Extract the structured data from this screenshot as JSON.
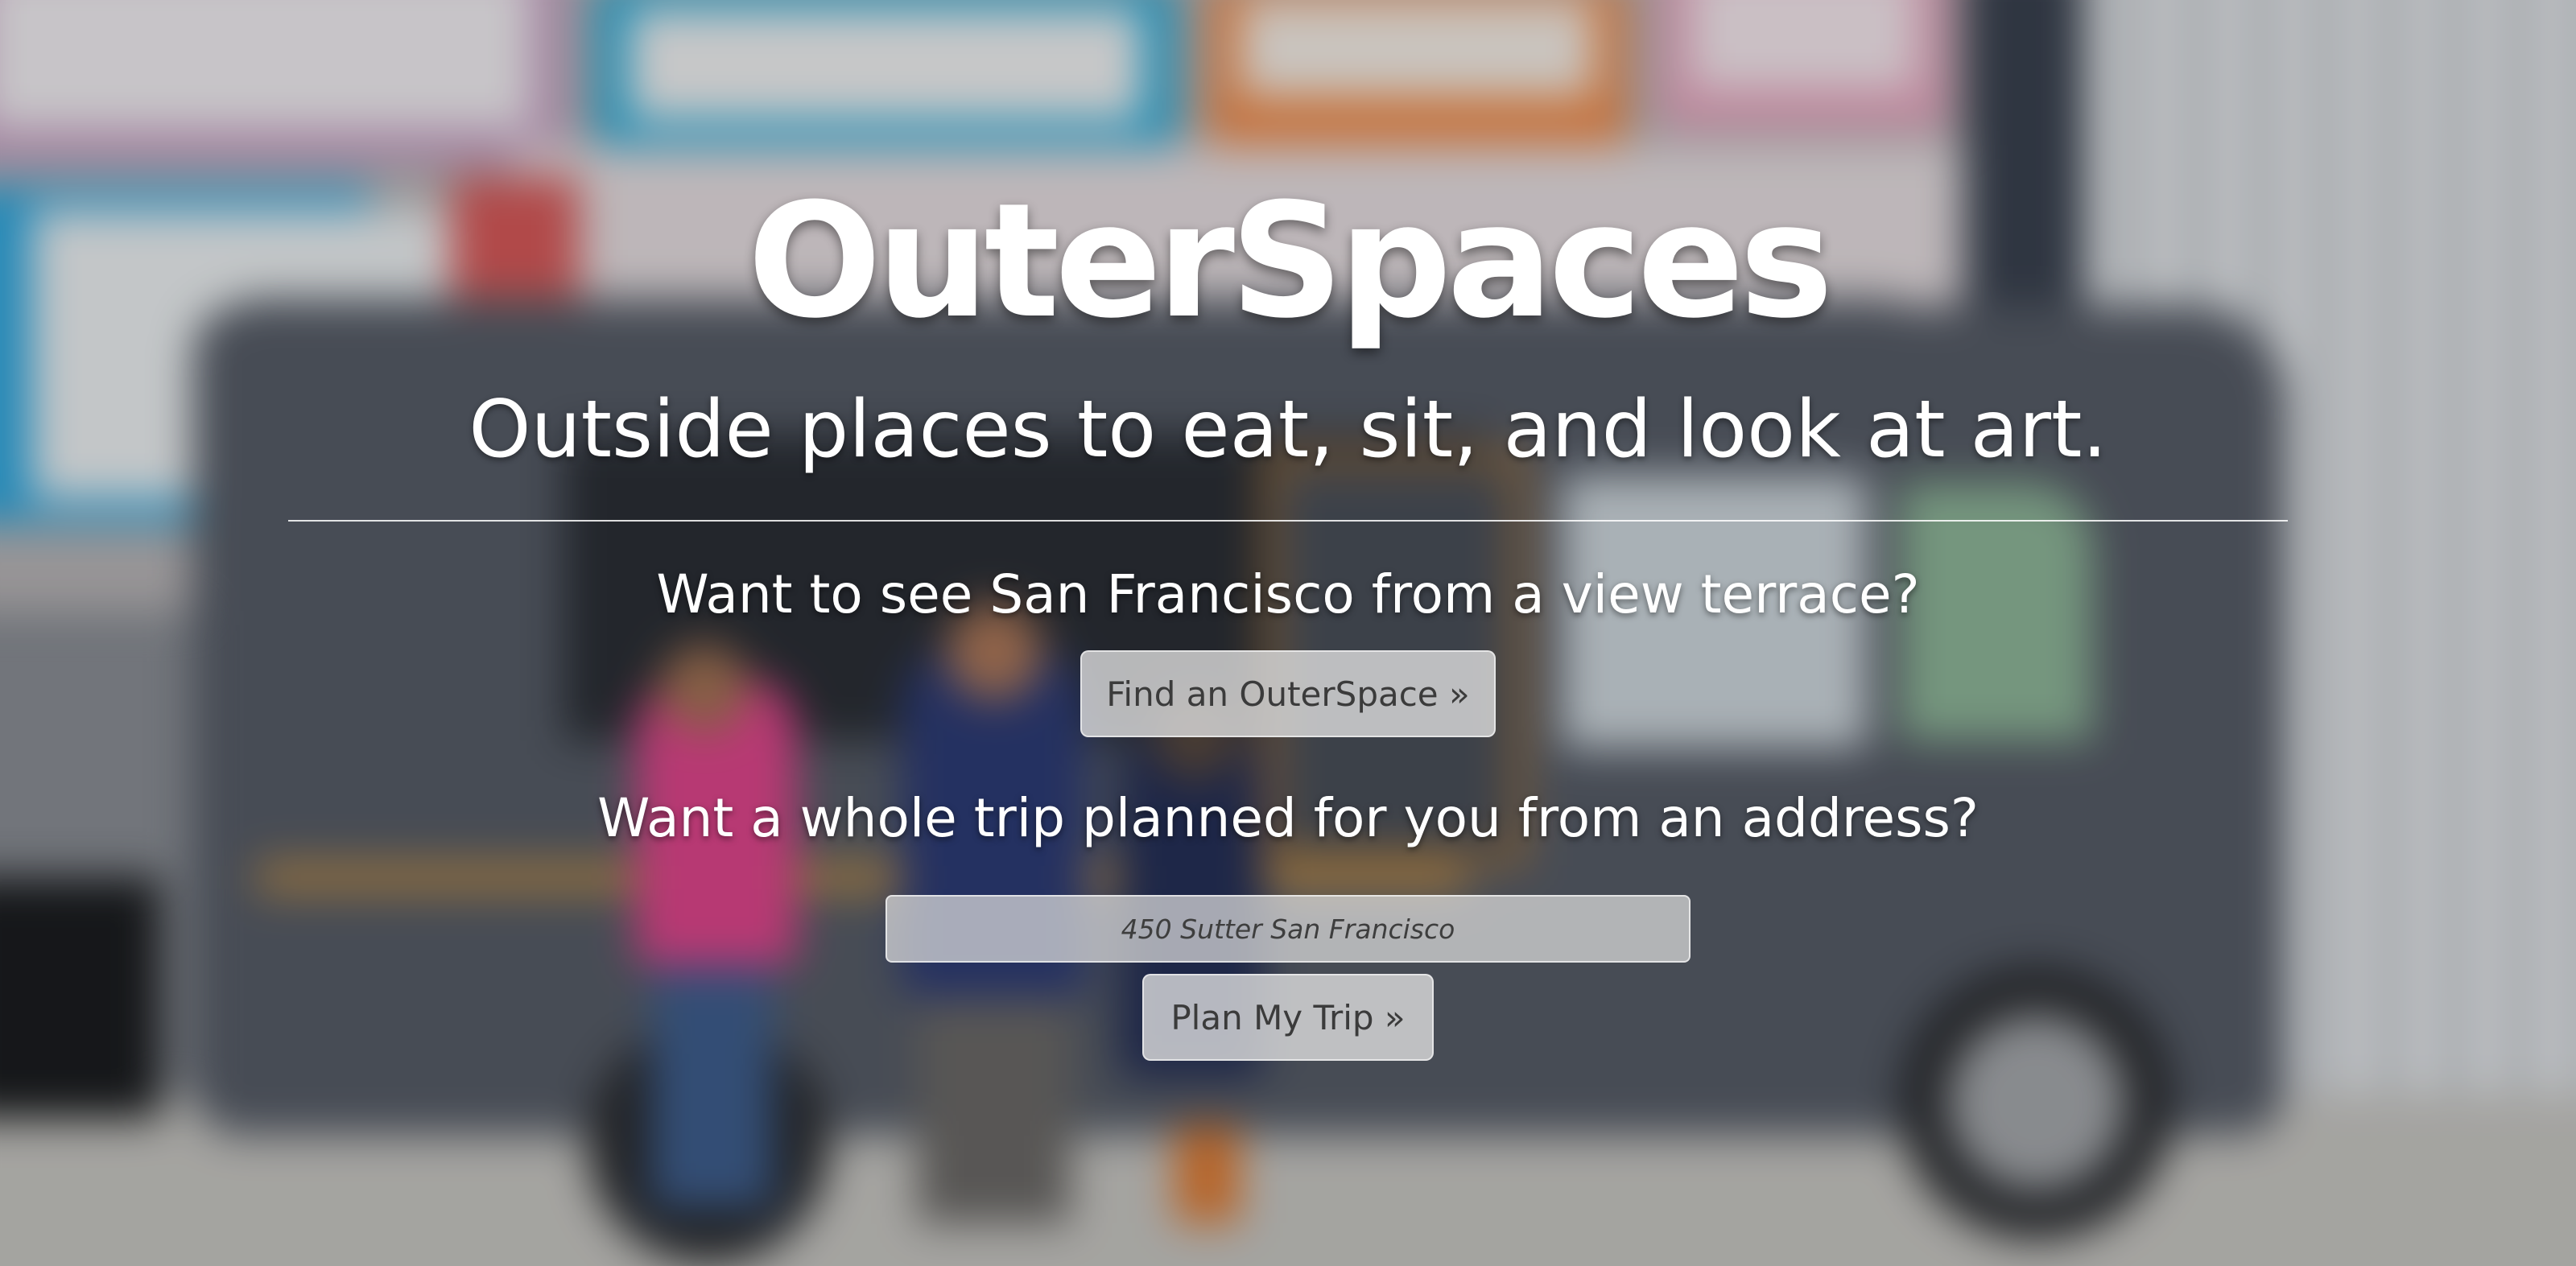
{
  "hero": {
    "brand": "OuterSpaces",
    "tagline": "Outside places to eat, sit, and look at art."
  },
  "finder": {
    "question": "Want to see San Francisco from a view terrace?",
    "button_label": "Find an OuterSpace »"
  },
  "planner": {
    "question": "Want a whole trip planned for you from an address?",
    "address_placeholder": "450 Sutter San Francisco",
    "button_label": "Plan My Trip »"
  },
  "background": {
    "description_icon": "food-truck-photo"
  }
}
